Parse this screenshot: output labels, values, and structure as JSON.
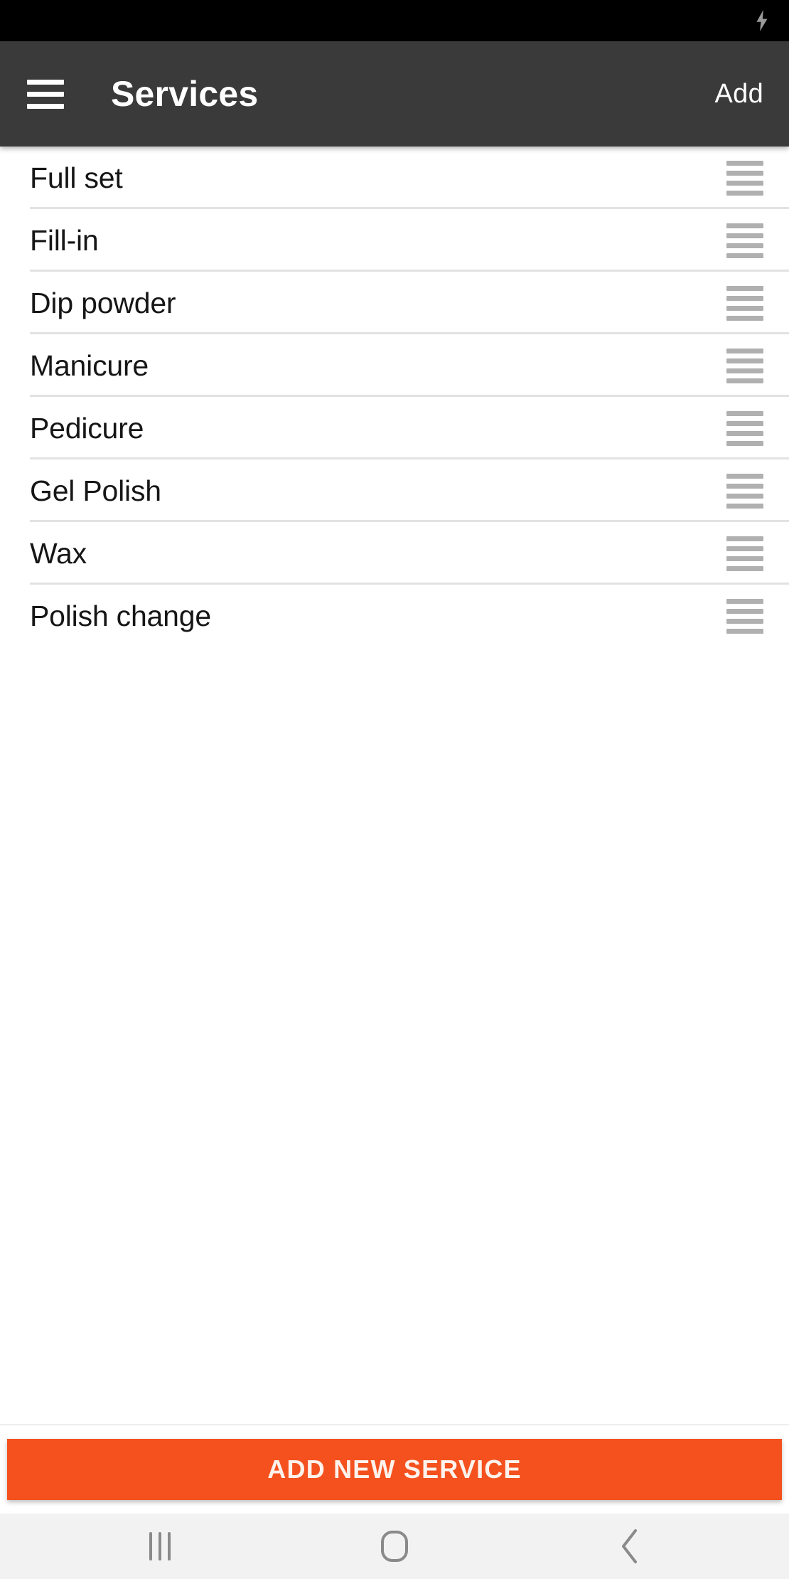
{
  "status_bar": {
    "icons": [
      {
        "name": "charging-bolt-icon",
        "glyph": "bolt"
      }
    ],
    "background": "#000000"
  },
  "app_bar": {
    "menu_icon": "hamburger-menu-icon",
    "title": "Services",
    "action_label": "Add",
    "background": "#3a3a3a",
    "text_color": "#ffffff"
  },
  "service_list": {
    "drag_handle_icon": "drag-handle-icon",
    "items": [
      {
        "name": "Full set"
      },
      {
        "name": "Fill-in"
      },
      {
        "name": "Dip powder"
      },
      {
        "name": "Manicure"
      },
      {
        "name": "Pedicure"
      },
      {
        "name": "Gel Polish"
      },
      {
        "name": "Wax"
      },
      {
        "name": "Polish change"
      }
    ]
  },
  "cta": {
    "label": "ADD NEW SERVICE",
    "background": "#f4511e",
    "text_color": "#fdf2ec"
  },
  "nav_bar": {
    "background": "#f2f2f2",
    "buttons": [
      {
        "name": "recents-icon"
      },
      {
        "name": "home-icon"
      },
      {
        "name": "back-icon"
      }
    ]
  }
}
